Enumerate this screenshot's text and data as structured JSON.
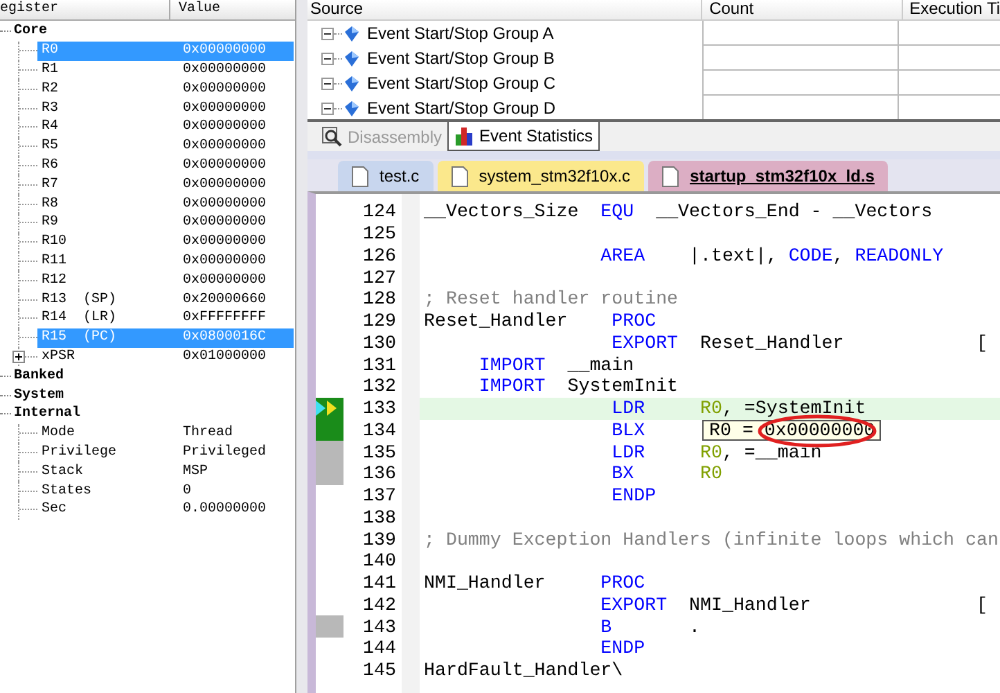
{
  "registers": {
    "columns": [
      "egister",
      "Value"
    ],
    "tree": [
      {
        "name": "Core",
        "expanded": true,
        "children": [
          {
            "name": "R0",
            "value": "0x00000000",
            "selected": true
          },
          {
            "name": "R1",
            "value": "0x00000000",
            "selected": false
          },
          {
            "name": "R2",
            "value": "0x00000000",
            "selected": false
          },
          {
            "name": "R3",
            "value": "0x00000000",
            "selected": false
          },
          {
            "name": "R4",
            "value": "0x00000000",
            "selected": false
          },
          {
            "name": "R5",
            "value": "0x00000000",
            "selected": false
          },
          {
            "name": "R6",
            "value": "0x00000000",
            "selected": false
          },
          {
            "name": "R7",
            "value": "0x00000000",
            "selected": false
          },
          {
            "name": "R8",
            "value": "0x00000000",
            "selected": false
          },
          {
            "name": "R9",
            "value": "0x00000000",
            "selected": false
          },
          {
            "name": "R10",
            "value": "0x00000000",
            "selected": false
          },
          {
            "name": "R11",
            "value": "0x00000000",
            "selected": false
          },
          {
            "name": "R12",
            "value": "0x00000000",
            "selected": false
          },
          {
            "name": "R13  (SP)",
            "value": "0x20000660",
            "selected": false
          },
          {
            "name": "R14  (LR)",
            "value": "0xFFFFFFFF",
            "selected": false
          },
          {
            "name": "R15  (PC)",
            "value": "0x0800016C",
            "selected": true
          },
          {
            "name": "xPSR",
            "value": "0x01000000",
            "selected": false,
            "expanded": false
          }
        ]
      },
      {
        "name": "Banked",
        "expanded": false
      },
      {
        "name": "System",
        "expanded": false
      },
      {
        "name": "Internal",
        "expanded": true,
        "children": [
          {
            "name": "Mode",
            "value": "Thread",
            "selected": false
          },
          {
            "name": "Privilege",
            "value": "Privileged",
            "selected": false
          },
          {
            "name": "Stack",
            "value": "MSP",
            "selected": false
          },
          {
            "name": "States",
            "value": "0",
            "selected": false
          },
          {
            "name": "Sec",
            "value": "0.00000000",
            "selected": false
          }
        ]
      }
    ]
  },
  "event_table": {
    "columns": [
      "Source",
      "Count",
      "Execution Ti"
    ],
    "rows": [
      {
        "source": "Event Start/Stop Group A"
      },
      {
        "source": "Event Start/Stop Group B"
      },
      {
        "source": "Event Start/Stop Group C"
      },
      {
        "source": "Event Start/Stop Group D"
      }
    ]
  },
  "panel_tabs": [
    {
      "label": "Disassembly",
      "kind": "disassembly",
      "selected": false
    },
    {
      "label": "Event Statistics",
      "kind": "statistics",
      "selected": true
    }
  ],
  "file_tabs": [
    {
      "label": "test.c",
      "color": "#c8d6ee",
      "selected": false
    },
    {
      "label": "system_stm32f10x.c",
      "color": "#fbe88c",
      "selected": false
    },
    {
      "label": "startup_stm32f10x_ld.s",
      "color": "#dcaec4",
      "selected": true
    }
  ],
  "editor": {
    "lines": [
      {
        "num": "124",
        "segs": [
          {
            "kind": "plain",
            "t": "__Vectors_Size  "
          },
          {
            "kind": "keyword",
            "t": "EQU"
          },
          {
            "kind": "plain",
            "t": "  __Vectors_End - __Vectors"
          }
        ]
      },
      {
        "num": "125"
      },
      {
        "num": "126",
        "segs": [
          {
            "kind": "keyword",
            "t": "                AREA"
          },
          {
            "kind": "plain",
            "t": "    |.text|, "
          },
          {
            "kind": "keyword",
            "t": "CODE"
          },
          {
            "kind": "plain",
            "t": ", "
          },
          {
            "kind": "keyword",
            "t": "READONLY"
          }
        ]
      },
      {
        "num": "127"
      },
      {
        "num": "128",
        "segs": [
          {
            "kind": "comment",
            "t": "; Reset handler routine"
          }
        ]
      },
      {
        "num": "129",
        "segs": [
          {
            "kind": "plain",
            "t": "Reset_Handler    "
          },
          {
            "kind": "keyword",
            "t": "PROC"
          }
        ]
      },
      {
        "num": "130",
        "segs": [
          {
            "kind": "keyword",
            "t": "                 EXPORT"
          },
          {
            "kind": "plain",
            "t": "  Reset_Handler"
          },
          {
            "kind": "plain",
            "t": "            ["
          }
        ]
      },
      {
        "num": "131",
        "segs": [
          {
            "kind": "keyword",
            "t": "     IMPORT"
          },
          {
            "kind": "plain",
            "t": "  __main"
          }
        ]
      },
      {
        "num": "132",
        "segs": [
          {
            "kind": "keyword",
            "t": "     IMPORT"
          },
          {
            "kind": "plain",
            "t": "  SystemInit"
          }
        ]
      },
      {
        "num": "133",
        "kind": "current",
        "segs": [
          {
            "kind": "keyword",
            "t": "                 LDR"
          },
          {
            "kind": "register",
            "t": "     R0"
          },
          {
            "kind": "plain",
            "t": ", =SystemInit"
          }
        ]
      },
      {
        "num": "134",
        "kind": "executed",
        "segs": [
          {
            "kind": "keyword",
            "t": "                 BLX"
          }
        ],
        "tooltip": "R0 = 0x00000000"
      },
      {
        "num": "135",
        "kind": "code",
        "segs": [
          {
            "kind": "keyword",
            "t": "                 LDR"
          },
          {
            "kind": "register",
            "t": "     R0"
          },
          {
            "kind": "plain",
            "t": ", =__main"
          }
        ]
      },
      {
        "num": "136",
        "kind": "code",
        "segs": [
          {
            "kind": "keyword",
            "t": "                 BX"
          },
          {
            "kind": "register",
            "t": "      R0"
          }
        ]
      },
      {
        "num": "137",
        "segs": [
          {
            "kind": "keyword",
            "t": "                 ENDP"
          }
        ]
      },
      {
        "num": "138"
      },
      {
        "num": "139",
        "segs": [
          {
            "kind": "comment",
            "t": "; Dummy Exception Handlers (infinite loops which can"
          }
        ]
      },
      {
        "num": "140"
      },
      {
        "num": "141",
        "segs": [
          {
            "kind": "plain",
            "t": "NMI_Handler     "
          },
          {
            "kind": "keyword",
            "t": "PROC"
          }
        ]
      },
      {
        "num": "142",
        "segs": [
          {
            "kind": "keyword",
            "t": "                EXPORT"
          },
          {
            "kind": "plain",
            "t": "  NMI_Handler"
          },
          {
            "kind": "plain",
            "t": "               ["
          }
        ]
      },
      {
        "num": "143",
        "kind": "code",
        "segs": [
          {
            "kind": "keyword",
            "t": "                B"
          },
          {
            "kind": "plain",
            "t": "       ."
          }
        ]
      },
      {
        "num": "144",
        "segs": [
          {
            "kind": "keyword",
            "t": "                ENDP"
          }
        ]
      },
      {
        "num": "145",
        "segs": [
          {
            "kind": "plain",
            "t": "HardFault_Handler\\"
          }
        ]
      }
    ]
  }
}
